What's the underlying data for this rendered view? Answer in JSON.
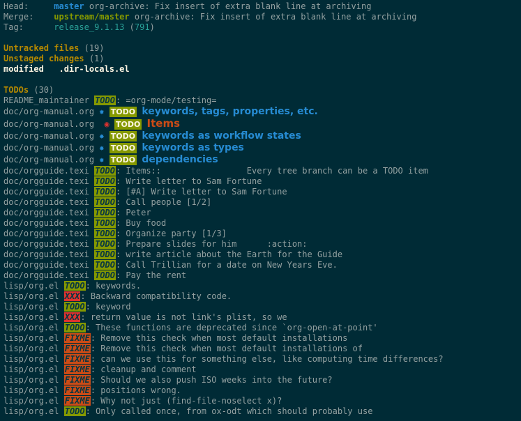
{
  "header": {
    "head": {
      "label": "Head:",
      "branch": "master",
      "message": "org-archive: Fix insert of extra blank line at archiving"
    },
    "merge": {
      "label": "Merge:",
      "branch": "upstream/master",
      "message": "org-archive: Fix insert of extra blank line at archiving"
    },
    "tag": {
      "label": "Tag:",
      "name": "release_9.1.13",
      "count": "791"
    }
  },
  "sections": {
    "untracked": {
      "title": "Untracked files",
      "count": "(19)"
    },
    "unstaged": {
      "title": "Unstaged changes",
      "count": "(1)"
    },
    "modified": {
      "status": "modified",
      "file": ".dir-locals.el"
    },
    "todos": {
      "title": "TODOs",
      "count": "(30)"
    }
  },
  "todos": [
    {
      "file": "README_maintainer",
      "kw": "TODO",
      "type": "todo",
      "text": ": =org-mode/testing="
    },
    {
      "file": "doc/org-manual.org",
      "big": true,
      "bullet": "✸",
      "badge": "TODO",
      "title": "keywords, tags, properties, etc."
    },
    {
      "file": "doc/org-manual.org",
      "big": true,
      "bullet": "◉",
      "bullet_red": true,
      "badge": "TODO",
      "title": "Items",
      "red": true
    },
    {
      "file": "doc/org-manual.org",
      "big": true,
      "bullet": "✸",
      "badge": "TODO",
      "title": "keywords as workflow states"
    },
    {
      "file": "doc/org-manual.org",
      "big": true,
      "bullet": "✸",
      "badge": "TODO",
      "title": "keywords as types"
    },
    {
      "file": "doc/org-manual.org",
      "big": true,
      "bullet": "✸",
      "badge": "TODO",
      "title": "dependencies"
    },
    {
      "file": "doc/orgguide.texi",
      "kw": "TODO",
      "type": "todo",
      "text": ": Items::                 Every tree branch can be a TODO item"
    },
    {
      "file": "doc/orgguide.texi",
      "kw": "TODO",
      "type": "todo",
      "text": ": Write letter to Sam Fortune"
    },
    {
      "file": "doc/orgguide.texi",
      "kw": "TODO",
      "type": "todo",
      "text": ": [#A] Write letter to Sam Fortune"
    },
    {
      "file": "doc/orgguide.texi",
      "kw": "TODO",
      "type": "todo",
      "text": ": Call people [1/2]"
    },
    {
      "file": "doc/orgguide.texi",
      "kw": "TODO",
      "type": "todo",
      "text": ": Peter"
    },
    {
      "file": "doc/orgguide.texi",
      "kw": "TODO",
      "type": "todo",
      "text": ": Buy food"
    },
    {
      "file": "doc/orgguide.texi",
      "kw": "TODO",
      "type": "todo",
      "text": ": Organize party [1/3]"
    },
    {
      "file": "doc/orgguide.texi",
      "kw": "TODO",
      "type": "todo",
      "text": ": Prepare slides for him      :action:"
    },
    {
      "file": "doc/orgguide.texi",
      "kw": "TODO",
      "type": "todo",
      "text": ": write article about the Earth for the Guide"
    },
    {
      "file": "doc/orgguide.texi",
      "kw": "TODO",
      "type": "todo",
      "text": ": Call Trillian for a date on New Years Eve."
    },
    {
      "file": "doc/orgguide.texi",
      "kw": "TODO",
      "type": "todo",
      "text": ": Pay the rent"
    },
    {
      "file": "lisp/org.el",
      "kw": "TODO",
      "type": "todo",
      "text": ": keywords."
    },
    {
      "file": "lisp/org.el",
      "kw": "XXX",
      "type": "xxx",
      "text": ": Backward compatibility code."
    },
    {
      "file": "lisp/org.el",
      "kw": "TODO",
      "type": "todo",
      "text": ": keyword"
    },
    {
      "file": "lisp/org.el",
      "kw": "XXX",
      "type": "xxx",
      "text": ": return value is not link's plist, so we"
    },
    {
      "file": "lisp/org.el",
      "kw": "TODO",
      "type": "todo",
      "text": ": These functions are deprecated since `org-open-at-point'"
    },
    {
      "file": "lisp/org.el",
      "kw": "FIXME",
      "type": "fixme",
      "text": ": Remove this check when most default installations"
    },
    {
      "file": "lisp/org.el",
      "kw": "FIXME",
      "type": "fixme",
      "text": ": Remove this check when most default installations of"
    },
    {
      "file": "lisp/org.el",
      "kw": "FIXME",
      "type": "fixme",
      "text": ": can we use this for something else, like computing time differences?"
    },
    {
      "file": "lisp/org.el",
      "kw": "FIXME",
      "type": "fixme",
      "text": ": cleanup and comment"
    },
    {
      "file": "lisp/org.el",
      "kw": "FIXME",
      "type": "fixme",
      "text": ": Should we also push ISO weeks into the future?"
    },
    {
      "file": "lisp/org.el",
      "kw": "FIXME",
      "type": "fixme",
      "text": ": positions wrong."
    },
    {
      "file": "lisp/org.el",
      "kw": "FIXME",
      "type": "fixme",
      "text": ": Why not just (find-file-noselect x)?"
    },
    {
      "file": "lisp/org.el",
      "kw": "TODO",
      "type": "todo",
      "text": ": Only called once, from ox-odt which should probably use"
    }
  ]
}
